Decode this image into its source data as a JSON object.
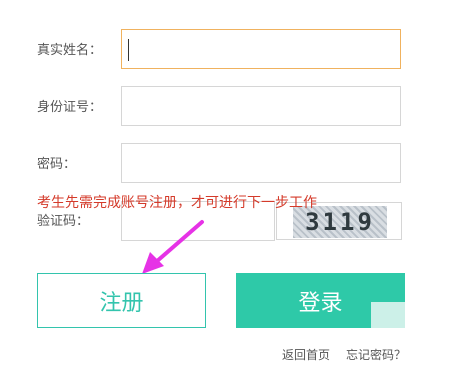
{
  "form": {
    "name_label": "真实姓名：",
    "id_label": "身份证号：",
    "password_label": "密码：",
    "captcha_label": "验证码：",
    "name_value": "",
    "id_value": "",
    "password_value": "",
    "captcha_value": "",
    "captcha_text": "3119"
  },
  "notice": "考生先需完成账号注册，才可进行下一步工作",
  "buttons": {
    "register": "注册",
    "login": "登录"
  },
  "footer": {
    "home": "返回首页",
    "forgot": "忘记密码？"
  },
  "colors": {
    "accent": "#2ec9a8",
    "notice": "#d43a2a",
    "arrow": "#e632e6",
    "focus_border": "#f0b25e"
  },
  "icons": {
    "arrow": "magenta-arrow-icon"
  }
}
